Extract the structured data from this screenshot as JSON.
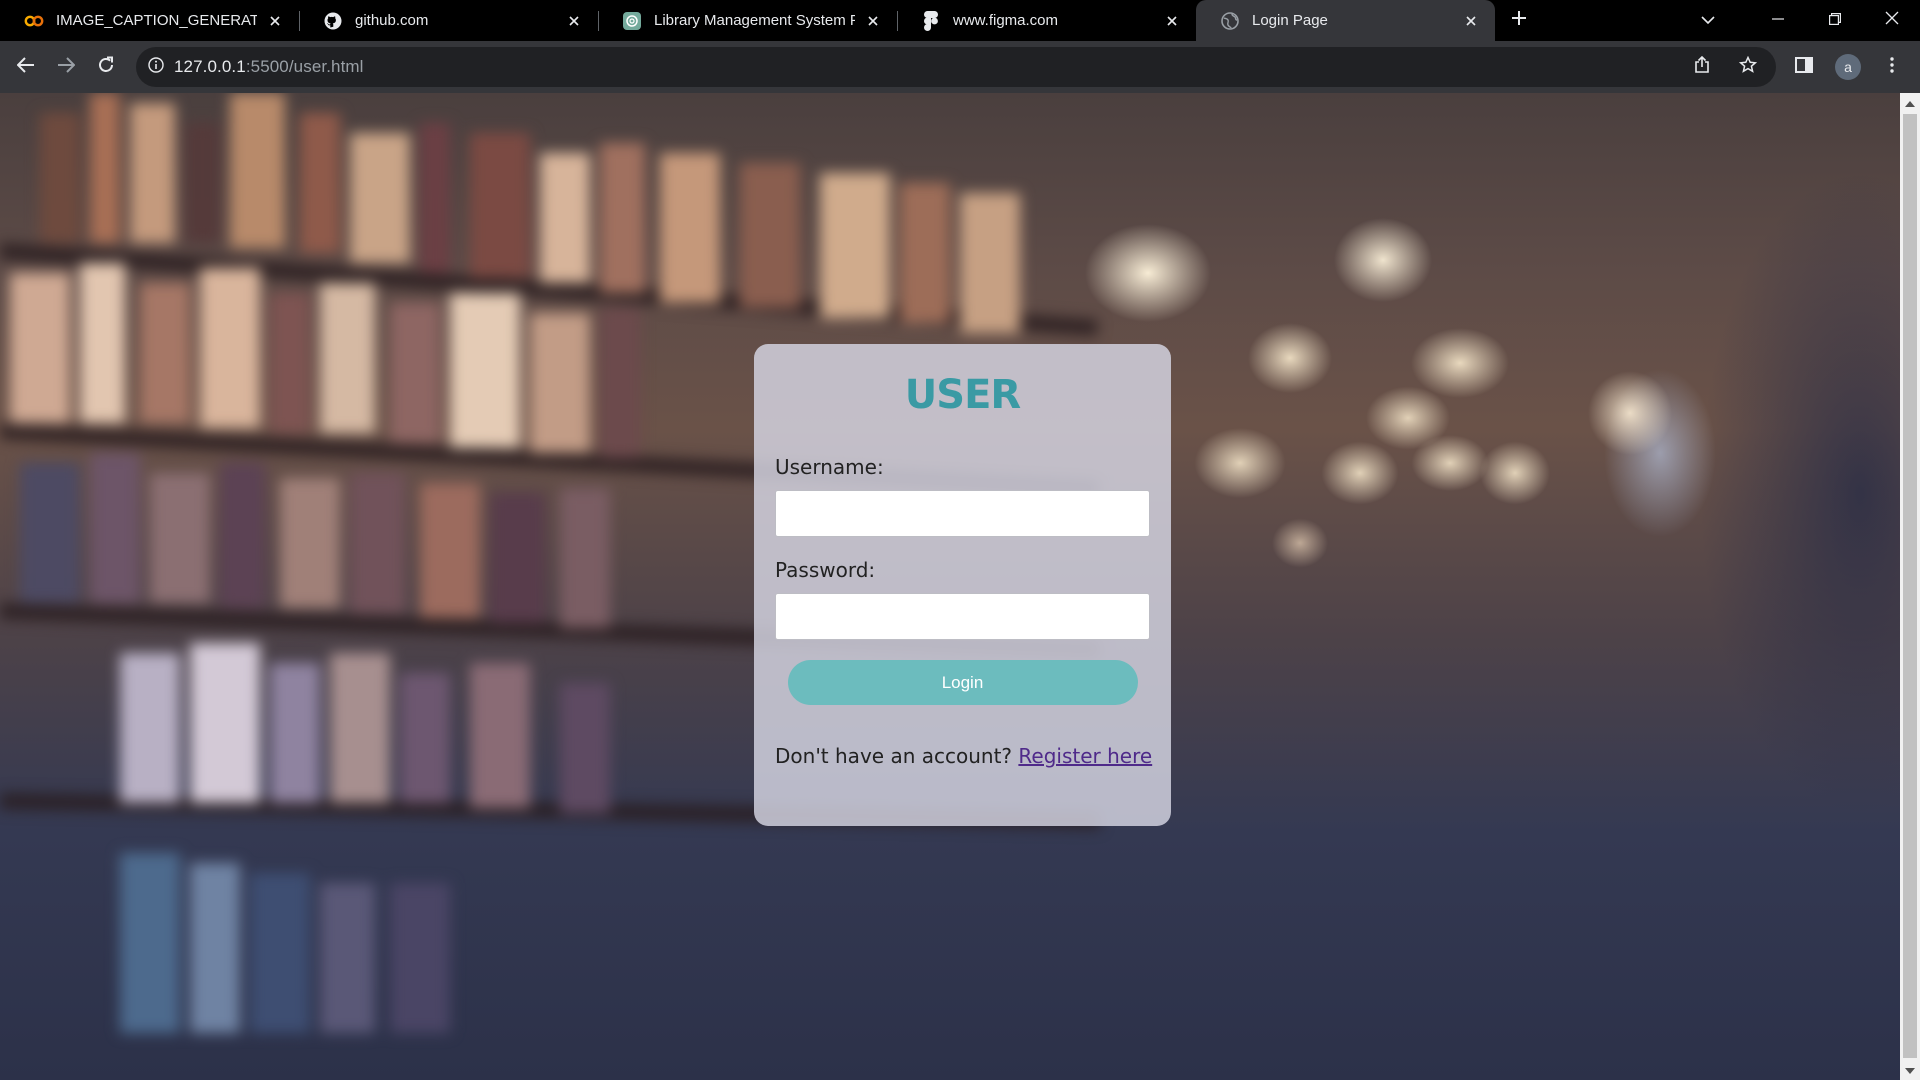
{
  "browser": {
    "tabs": [
      {
        "title": "IMAGE_CAPTION_GENERATOR.ip",
        "icon": "colab-icon",
        "active": false
      },
      {
        "title": "github.com",
        "icon": "github-icon",
        "active": false
      },
      {
        "title": "Library Management System Pur",
        "icon": "chatgpt-icon",
        "active": false
      },
      {
        "title": "www.figma.com",
        "icon": "figma-icon",
        "active": false
      },
      {
        "title": "Login Page",
        "icon": "globe-icon",
        "active": true
      }
    ],
    "address": {
      "host": "127.0.0.1",
      "path": ":5500/user.html"
    },
    "profile_initial": "a"
  },
  "page": {
    "heading": "USER",
    "username_label": "Username:",
    "username_value": "",
    "password_label": "Password:",
    "password_value": "",
    "login_button": "Login",
    "register_prompt": "Don't have an account?",
    "register_link": "Register here"
  },
  "colors": {
    "heading": "#3a9aa4",
    "login_button": "#6cbcbe",
    "link": "#4f2a8a"
  }
}
